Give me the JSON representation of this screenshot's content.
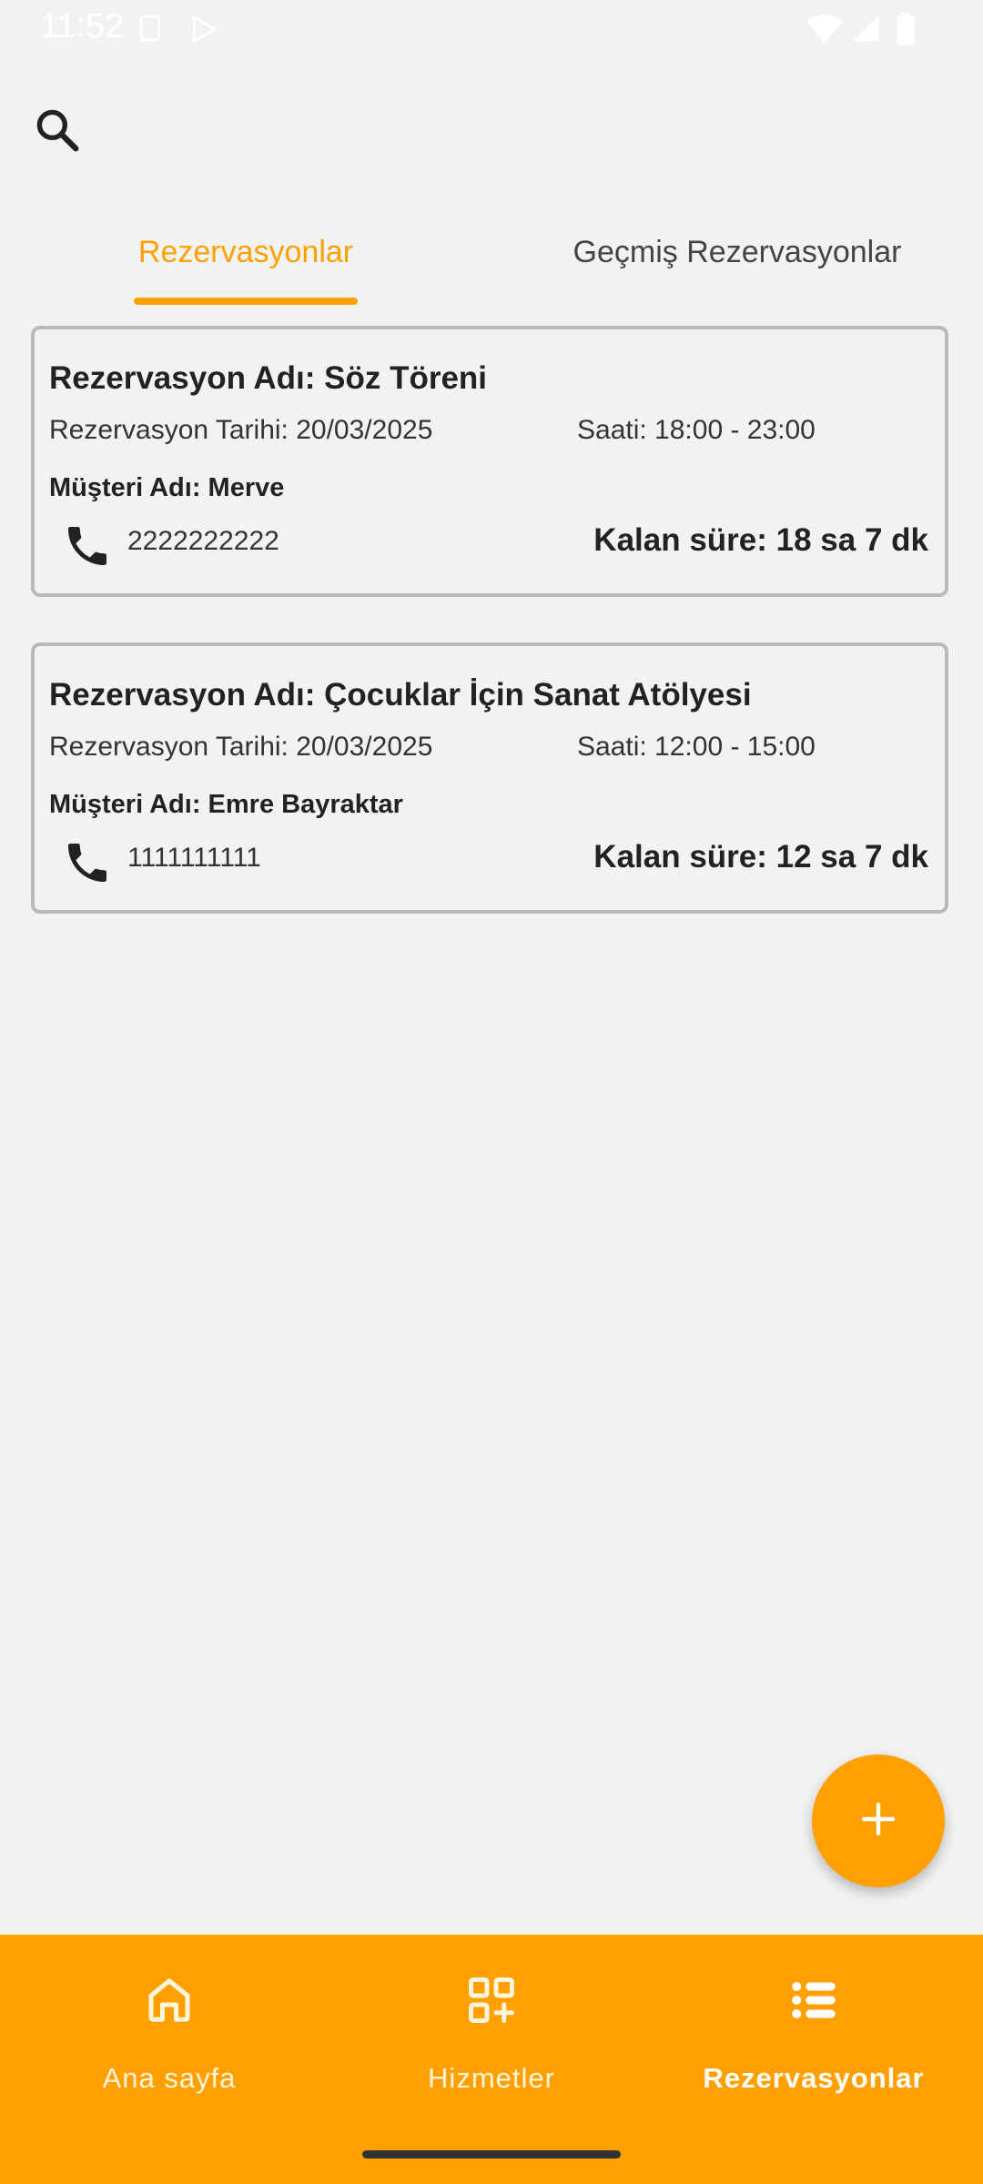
{
  "status_bar": {
    "time": "11:52",
    "icons": [
      "screenshot-icon",
      "play-store-icon",
      "wifi-icon",
      "cellular-signal-icon",
      "battery-icon"
    ]
  },
  "tabs": [
    {
      "label": "Rezervasyonlar",
      "active": true
    },
    {
      "label": "Geçmiş Rezervasyonlar",
      "active": false
    }
  ],
  "reservations": [
    {
      "title": "Rezervasyon Adı: Söz Töreni",
      "date": "Rezervasyon Tarihi: 20/03/2025",
      "time": "Saati: 18:00 - 23:00",
      "customer": "Müşteri Adı: Merve",
      "phone": "2222222222",
      "remaining": "Kalan süre: 18 sa 7 dk"
    },
    {
      "title": "Rezervasyon Adı: Çocuklar İçin Sanat Atölyesi",
      "date": "Rezervasyon Tarihi: 20/03/2025",
      "time": "Saati: 12:00 - 15:00",
      "customer": "Müşteri Adı: Emre Bayraktar",
      "phone": "1111111111",
      "remaining": "Kalan süre: 12 sa 7 dk"
    }
  ],
  "bottom_nav": [
    {
      "label": "Ana sayfa",
      "icon": "home-icon",
      "active": false
    },
    {
      "label": "Hizmetler",
      "icon": "services-grid-icon",
      "active": false
    },
    {
      "label": "Rezervasyonlar",
      "icon": "list-icon",
      "active": true
    }
  ],
  "colors": {
    "accent": "#ffa000",
    "background": "#f2f2f2",
    "card_border": "#b9b9b9",
    "text_primary": "#222222"
  }
}
